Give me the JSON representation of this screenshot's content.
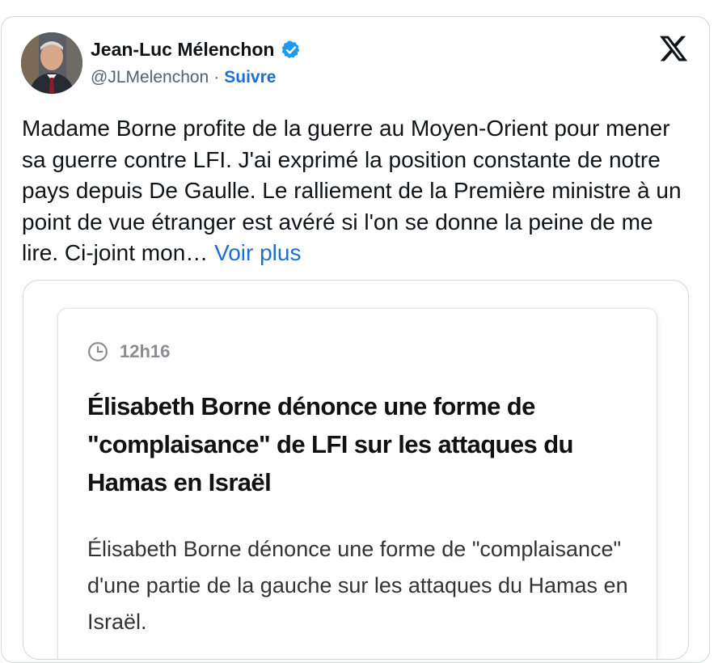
{
  "author": {
    "name": "Jean-Luc Mélenchon",
    "handle": "@JLMelenchon",
    "separator": "·",
    "follow_label": "Suivre"
  },
  "tweet": {
    "text": "Madame Borne profite de la guerre au Moyen-Orient pour mener sa guerre contre LFI. J'ai exprimé la position constante de notre pays depuis De Gaulle. Le ralliement de la Première ministre à un point de vue étranger est avéré si l'on se donne la peine de me lire. Ci-joint mon…",
    "more_label": "Voir plus"
  },
  "article": {
    "time": "12h16",
    "headline": "Élisabeth Borne dénonce une forme de \"complaisance\" de LFI sur les attaques du Hamas en Israël",
    "summary": "Élisabeth Borne dénonce une forme de \"complaisance\" d'une partie de la gauche sur les attaques du Hamas en Israël."
  },
  "colors": {
    "link": "#1d6fd1",
    "verified": "#1d9bf0",
    "text": "#0f1419",
    "muted": "#536471",
    "border": "#cfd9de"
  },
  "icons": [
    "verified-badge-icon",
    "x-logo-icon",
    "clock-icon"
  ]
}
